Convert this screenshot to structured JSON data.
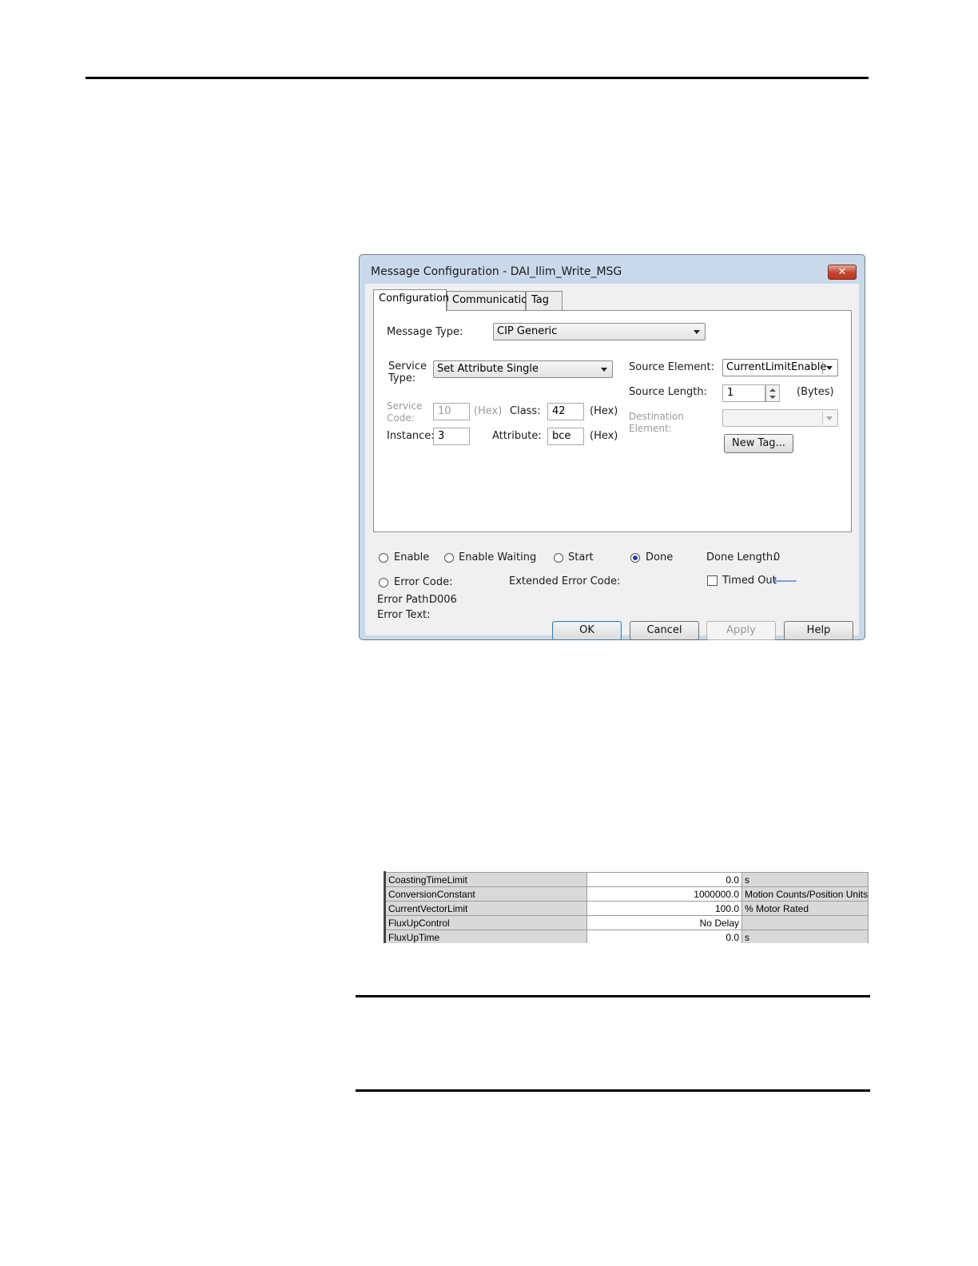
{
  "dialog": {
    "title": "Message Configuration - DAI_Ilim_Write_MSG",
    "close_label": "✕",
    "tabs": [
      {
        "label": "Configuration"
      },
      {
        "label": "Communication"
      },
      {
        "label": "Tag"
      }
    ],
    "message_type": {
      "label": "Message Type:",
      "value": "CIP Generic"
    },
    "service_type": {
      "label_1": "Service",
      "label_2": "Type:",
      "value": "Set Attribute Single"
    },
    "service_code": {
      "label_1": "Service",
      "label_2": "Code:",
      "value": "10",
      "unit": "(Hex)"
    },
    "class": {
      "label": "Class:",
      "value": "42",
      "unit": "(Hex)"
    },
    "instance": {
      "label": "Instance:",
      "value": "3"
    },
    "attribute": {
      "label": "Attribute:",
      "value": "bce",
      "unit": "(Hex)"
    },
    "source_element": {
      "label": "Source Element:",
      "value": "CurrentLimitEnable"
    },
    "source_length": {
      "label": "Source Length:",
      "value": "1",
      "unit": "(Bytes)"
    },
    "destination_element": {
      "label_1": "Destination",
      "label_2": "Element:",
      "value": ""
    },
    "new_tag_label": "New Tag...",
    "status": {
      "enable": "Enable",
      "enable_waiting": "Enable Waiting",
      "start": "Start",
      "done": "Done",
      "done_length_label": "Done Length:",
      "done_length_value": "0",
      "error_code": "Error Code:",
      "extended_error_code": "Extended Error Code:",
      "timed_out": "Timed Out",
      "error_path_label": "Error Path:",
      "error_path_value": "D006",
      "error_text_label": "Error Text:"
    },
    "buttons": {
      "ok": "OK",
      "cancel": "Cancel",
      "apply": "Apply",
      "help": "Help"
    }
  },
  "parameter_table": {
    "rows": [
      {
        "name": "CoastingTimeLimit",
        "value": "0.0",
        "unit": "s"
      },
      {
        "name": "ConversionConstant",
        "value": "1000000.0",
        "unit": "Motion Counts/Position Units"
      },
      {
        "name": "CurrentVectorLimit",
        "value": "100.0",
        "unit": "% Motor Rated"
      },
      {
        "name": "FluxUpControl",
        "value": "No Delay",
        "unit": ""
      },
      {
        "name": "FluxUpTime",
        "value": "0.0",
        "unit": "s"
      }
    ]
  }
}
